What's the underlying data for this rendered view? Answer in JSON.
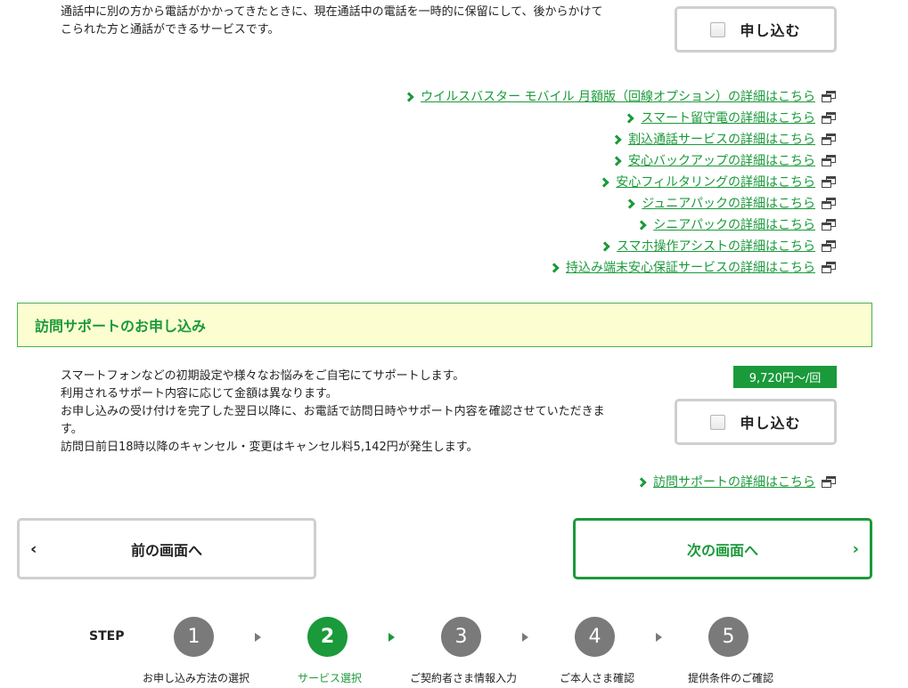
{
  "top_service": {
    "description_lines": [
      "通話中に別の方から電話がかかってきたときに、現在通話中の電話を一時的に保留にして、後からかけて",
      "こられた方と通話ができるサービスです。"
    ],
    "apply_label": "申し込む"
  },
  "detail_links": [
    "ウイルスバスター モバイル 月額版（回線オプション）の詳細はこちら",
    "スマート留守電の詳細はこちら",
    "割込通話サービスの詳細はこちら",
    "安心バックアップの詳細はこちら",
    "安心フィルタリングの詳細はこちら",
    "ジュニアパックの詳細はこちら",
    "シニアパックの詳細はこちら",
    "スマホ操作アシストの詳細はこちら",
    "持込み端末安心保証サービスの詳細はこちら"
  ],
  "visit_support": {
    "heading": "訪問サポートのお申し込み",
    "price": "9,720円～/回",
    "description_lines": [
      "スマートフォンなどの初期設定や様々なお悩みをご自宅にてサポートします。",
      "利用されるサポート内容に応じて金額は異なります。",
      "お申し込みの受け付けを完了した翌日以降に、お電話で訪問日時やサポート内容を確認させていただきま",
      "す。",
      "訪問日前日18時以降のキャンセル・変更はキャンセル料5,142円が発生します。"
    ],
    "apply_label": "申し込む",
    "detail_link": "訪問サポートの詳細はこちら"
  },
  "navigation": {
    "prev_label": "前の画面へ",
    "next_label": "次の画面へ",
    "prev_arrow": "‹",
    "next_arrow": "›"
  },
  "steps": {
    "label": "STEP",
    "items": [
      {
        "number": "1",
        "name": "お申し込み方法の選択",
        "active": false
      },
      {
        "number": "2",
        "name": "サービス選択",
        "active": true
      },
      {
        "number": "3",
        "name": "ご契約者さま情報入力",
        "active": false
      },
      {
        "number": "4",
        "name": "ご本人さま確認",
        "active": false
      },
      {
        "number": "5",
        "name": "提供条件のご確認",
        "active": false
      }
    ]
  },
  "colors": {
    "accent_green": "#1a9a3a",
    "section_bg": "#fdfdd2",
    "step_inactive": "#7a7a7a"
  }
}
